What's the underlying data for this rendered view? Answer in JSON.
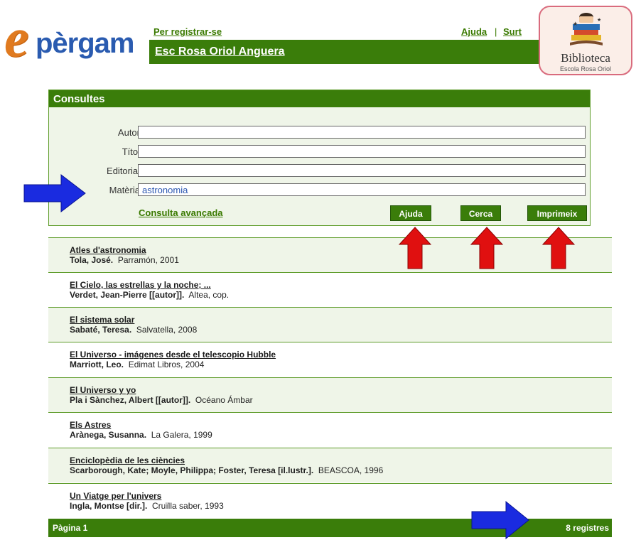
{
  "header": {
    "logo_e": "e",
    "logo_word": "pèrgam",
    "register_link": "Per registrar-se",
    "help_link": "Ajuda",
    "separator": "|",
    "exit_link": "Surt",
    "school_name": "Esc Rosa Oriol Anguera"
  },
  "badge": {
    "title": "Biblioteca",
    "subtitle": "Escola Rosa Oriol"
  },
  "search": {
    "title": "Consultes",
    "fields": [
      {
        "label": "Autor",
        "value": ""
      },
      {
        "label": "Títol",
        "value": ""
      },
      {
        "label": "Editorial",
        "value": ""
      },
      {
        "label": "Matèria",
        "value": "astronomia"
      }
    ],
    "advanced_link": "Consulta avançada",
    "buttons": {
      "help": "Ajuda",
      "search": "Cerca",
      "print": "Imprimeix"
    }
  },
  "results": {
    "items": [
      {
        "title": "Atles d'astronomia",
        "author": "Tola, José.",
        "publisher": "Parramón, 2001"
      },
      {
        "title": "El Cielo, las estrellas y la noche; ...",
        "author": "Verdet, Jean-Pierre [[autor]].",
        "publisher": "Altea, cop."
      },
      {
        "title": "El sistema solar",
        "author": "Sabaté, Teresa.",
        "publisher": "Salvatella, 2008"
      },
      {
        "title": "El Universo - imágenes desde el telescopio Hubble",
        "author": "Marriott, Leo.",
        "publisher": "Edimat Libros, 2004"
      },
      {
        "title": "El Universo y yo",
        "author": "Pla i Sànchez, Albert [[autor]].",
        "publisher": "Océano Ámbar"
      },
      {
        "title": "Els Astres",
        "author": "Arànega, Susanna.",
        "publisher": "La Galera, 1999"
      },
      {
        "title": "Enciclopèdia de les ciències",
        "author": "Scarborough, Kate; Moyle, Philippa; Foster, Teresa [il.lustr.].",
        "publisher": "BEASCOA, 1996"
      },
      {
        "title": "Un Viatge per l'univers",
        "author": "Ingla, Montse [dir.].",
        "publisher": "Cruïlla saber, 1993"
      }
    ],
    "page_label": "Pàgina 1",
    "count_label": "8 registres"
  },
  "colors": {
    "green": "#3a7d0a",
    "panel_bg": "#eff5e8",
    "blue_arrow": "#1a2be0",
    "red_arrow": "#e01010"
  },
  "icons": [
    "blue-arrow-right-icon",
    "red-arrow-up-icon",
    "library-books-icon"
  ]
}
